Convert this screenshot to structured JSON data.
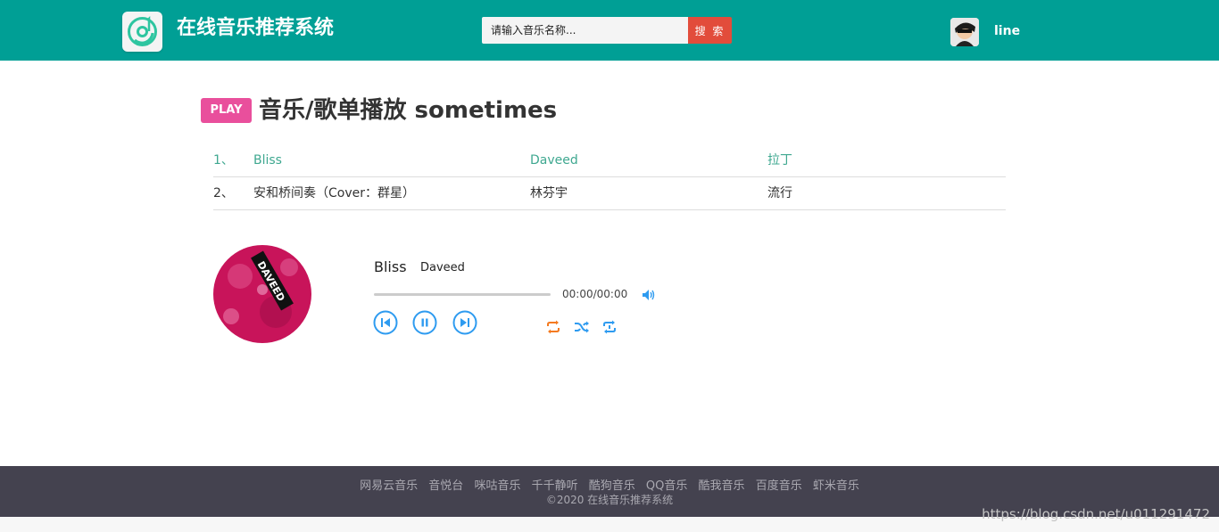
{
  "header": {
    "site_title": "在线音乐推荐系统",
    "search_placeholder": "请输入音乐名称...",
    "search_button": "搜 索",
    "username": "line",
    "bg_color": "#009f95",
    "logo_icon": "music-disc-icon"
  },
  "main": {
    "badge": "PLAY",
    "heading": "音乐/歌单播放 sometimes",
    "tracks": [
      {
        "num": "1、",
        "title": "Bliss",
        "artist": "Daveed",
        "genre": "拉丁"
      },
      {
        "num": "2、",
        "title": "安和桥间奏（Cover：群星）",
        "artist": "林芬宇",
        "genre": "流行"
      }
    ]
  },
  "player": {
    "title": "Bliss",
    "artist": "Daveed",
    "time": "00:00/00:00",
    "progress": 0,
    "album_label": "DAVEED",
    "icons": [
      "volume-icon",
      "prev-icon",
      "pause-icon",
      "next-icon",
      "repeat-icon",
      "shuffle-icon",
      "repeat-one-icon"
    ],
    "accent": "#2e9bf0",
    "mode_accent": "#f47a20"
  },
  "footer": {
    "links": [
      "网易云音乐",
      "音悦台",
      "咪咕音乐",
      "千千静听",
      "酷狗音乐",
      "QQ音乐",
      "酷我音乐",
      "百度音乐",
      "虾米音乐"
    ],
    "copyright": "©2020 在线音乐推荐系统"
  },
  "watermark": "https://blog.csdn.net/u011291472"
}
